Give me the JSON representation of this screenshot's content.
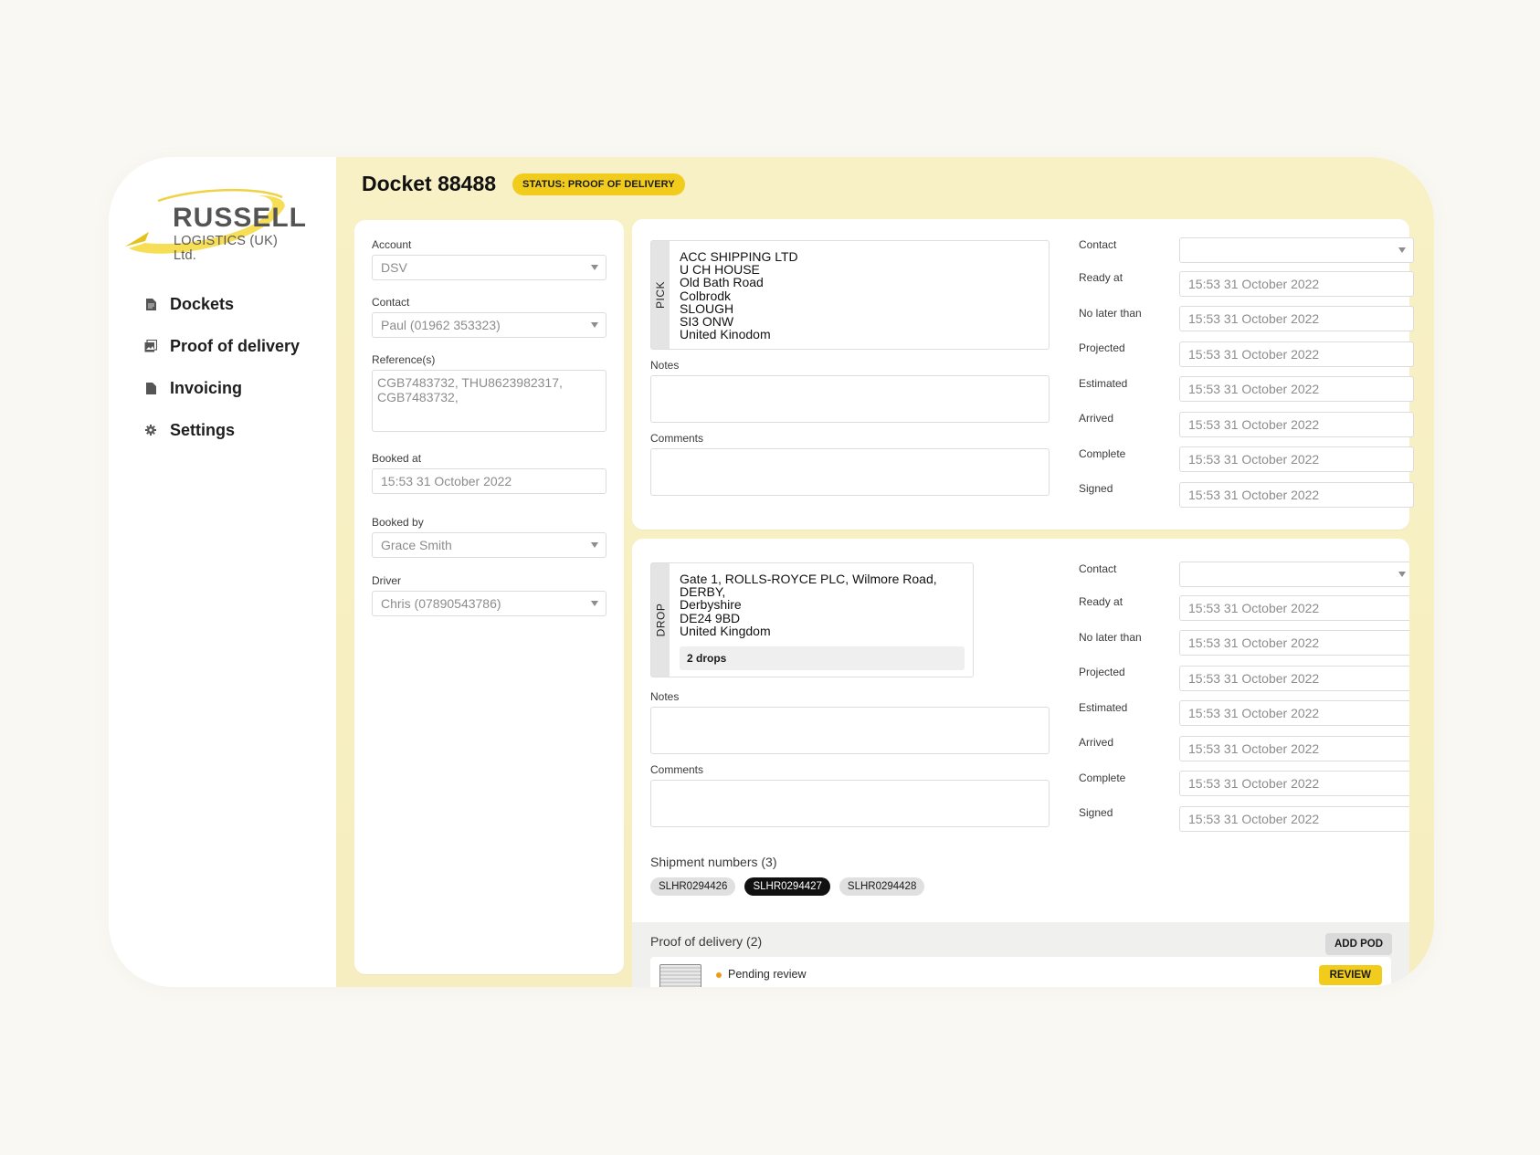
{
  "brand": {
    "name": "RUSSELL",
    "subtitle": "LOGISTICS (UK) Ltd.",
    "accent": "#f2cc1d"
  },
  "nav": [
    {
      "label": "Dockets",
      "icon": "document-icon"
    },
    {
      "label": "Proof of delivery",
      "icon": "gallery-icon"
    },
    {
      "label": "Invoicing",
      "icon": "file-icon"
    },
    {
      "label": "Settings",
      "icon": "gear-icon"
    }
  ],
  "header": {
    "title": "Docket 88488",
    "status": "STATUS: PROOF OF DELIVERY"
  },
  "details": {
    "account_label": "Account",
    "account_value": "DSV",
    "contact_label": "Contact",
    "contact_value": "Paul (01962 353323)",
    "references_label": "Reference(s)",
    "references_value": "CGB7483732, THU8623982317, CGB7483732,",
    "booked_at_label": "Booked at",
    "booked_at_value": "15:53 31 October 2022",
    "booked_by_label": "Booked by",
    "booked_by_value": "Grace Smith",
    "driver_label": "Driver",
    "driver_value": "Chris (07890543786)"
  },
  "pick": {
    "tab": "PICK",
    "address": [
      "ACC SHIPPING LTD",
      "U CH HOUSE",
      "Old Bath Road",
      "Colbrodk",
      "SLOUGH",
      "SI3 ONW",
      "United Kinodom"
    ],
    "notes_label": "Notes",
    "comments_label": "Comments",
    "contact_label": "Contact",
    "contact_value": "",
    "dates": [
      {
        "label": "Ready at",
        "value": "15:53 31 October 2022"
      },
      {
        "label": "No later than",
        "value": "15:53 31 October 2022"
      },
      {
        "label": "Projected",
        "value": "15:53 31 October 2022"
      },
      {
        "label": "Estimated",
        "value": "15:53 31 October 2022"
      },
      {
        "label": "Arrived",
        "value": "15:53 31 October 2022"
      },
      {
        "label": "Complete",
        "value": "15:53 31 October 2022"
      },
      {
        "label": "Signed",
        "value": "15:53 31 October 2022"
      }
    ]
  },
  "drop": {
    "tab": "DROP",
    "address": [
      "Gate 1, ROLLS-ROYCE PLC, Wilmore Road,",
      "DERBY,",
      "Derbyshire",
      "DE24 9BD",
      "United Kingdom"
    ],
    "drops_count": "2 drops",
    "notes_label": "Notes",
    "comments_label": "Comments",
    "contact_label": "Contact",
    "contact_value": "",
    "dates": [
      {
        "label": "Ready at",
        "value": "15:53 31 October 2022"
      },
      {
        "label": "No later than",
        "value": "15:53 31 October 2022"
      },
      {
        "label": "Projected",
        "value": "15:53 31 October 2022"
      },
      {
        "label": "Estimated",
        "value": "15:53 31 October 2022"
      },
      {
        "label": "Arrived",
        "value": "15:53 31 October 2022"
      },
      {
        "label": "Complete",
        "value": "15:53 31 October 2022"
      },
      {
        "label": "Signed",
        "value": "15:53 31 October 2022"
      }
    ]
  },
  "shipments": {
    "title": "Shipment numbers (3)",
    "items": [
      "SLHR0294426",
      "SLHR0294427",
      "SLHR0294428"
    ],
    "active_index": 1
  },
  "pod": {
    "title": "Proof of delivery (2)",
    "add_label": "ADD POD",
    "items": [
      {
        "status": "Pending review",
        "action": "REVIEW",
        "status_color": "#f09a1a"
      }
    ]
  }
}
